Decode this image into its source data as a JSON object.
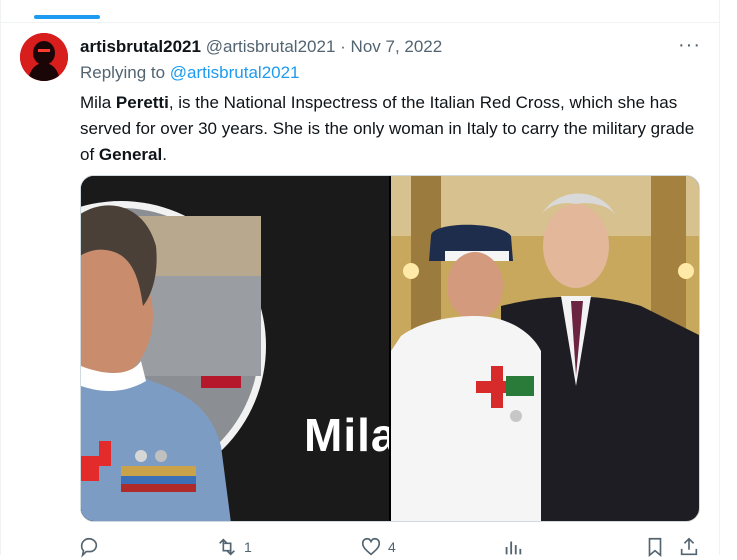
{
  "tweet": {
    "display_name": "artisbrutal2021",
    "handle": "@artisbrutal2021",
    "separator": "·",
    "date": "Nov 7, 2022",
    "reply_prefix": "Replying to",
    "reply_handle": "@artisbrutal2021",
    "text_1": "Mila ",
    "text_bold_1": "Peretti",
    "text_2": ", is the National Inspectress of the Italian Red Cross, which she has served for over 30 years. She is the only woman in Italy to carry the military grade of ",
    "text_bold_2": "General",
    "text_3": ".",
    "more_label": "···"
  },
  "media": {
    "left_photo_text": "Mila"
  },
  "actions": {
    "reply_count": "",
    "retweet_count": "1",
    "like_count": "4",
    "views_count": ""
  },
  "icons": [
    "more-icon",
    "reply-icon",
    "retweet-icon",
    "like-icon",
    "views-icon",
    "bookmark-icon",
    "share-icon"
  ],
  "colors": {
    "accent": "#1d9bf0",
    "text": "#0f1419",
    "muted": "#536471",
    "avatar_red": "#d81d1d"
  }
}
